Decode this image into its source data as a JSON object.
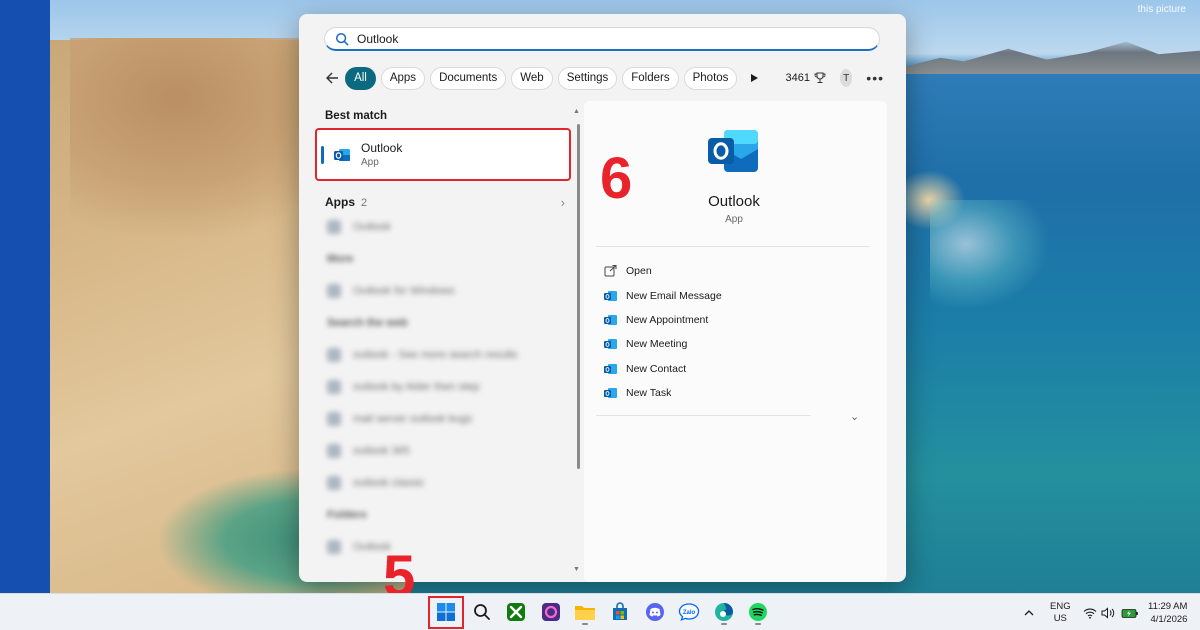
{
  "desktop": {
    "watermark_right": "this picture"
  },
  "search": {
    "query": "Outlook",
    "icon": "search-icon"
  },
  "filters": {
    "chips": [
      "All",
      "Apps",
      "Documents",
      "Web",
      "Settings",
      "Folders",
      "Photos"
    ],
    "active": "All",
    "points": "3461",
    "avatar_initial": "T"
  },
  "results": {
    "best_match_title": "Best match",
    "best_match": {
      "name": "Outlook",
      "type": "App"
    },
    "apps_label": "Apps",
    "apps_count": "2",
    "blurred_items": [
      "Outlook",
      "More",
      "Outlook for Windows",
      "Search the web",
      "outlook - See more search results",
      "outlook by Alder then step",
      "mail server outlook bugs",
      "outlook 365",
      "outlook classic",
      "Folders",
      "Outlook"
    ]
  },
  "detail": {
    "name": "Outlook",
    "type": "App",
    "actions": [
      "Open",
      "New Email Message",
      "New Appointment",
      "New Meeting",
      "New Contact",
      "New Task"
    ]
  },
  "annotations": {
    "step_five": "5",
    "step_six": "6"
  },
  "taskbar": {
    "apps": [
      "start-icon",
      "search-icon",
      "xbox-icon",
      "clipchamp-icon",
      "file-explorer-icon",
      "store-icon",
      "discord-icon",
      "zalo-icon",
      "edge-icon",
      "spotify-icon"
    ],
    "zalo_label": "Zalo",
    "lang_line1": "ENG",
    "lang_line2": "US",
    "time": "11:29 AM",
    "date": "4/1/2026"
  },
  "colors": {
    "accent": "#0b6a80",
    "outlook_blue": "#0f6cbd",
    "annotation_red": "#e8242a",
    "desktop_band": "#1550b0"
  }
}
